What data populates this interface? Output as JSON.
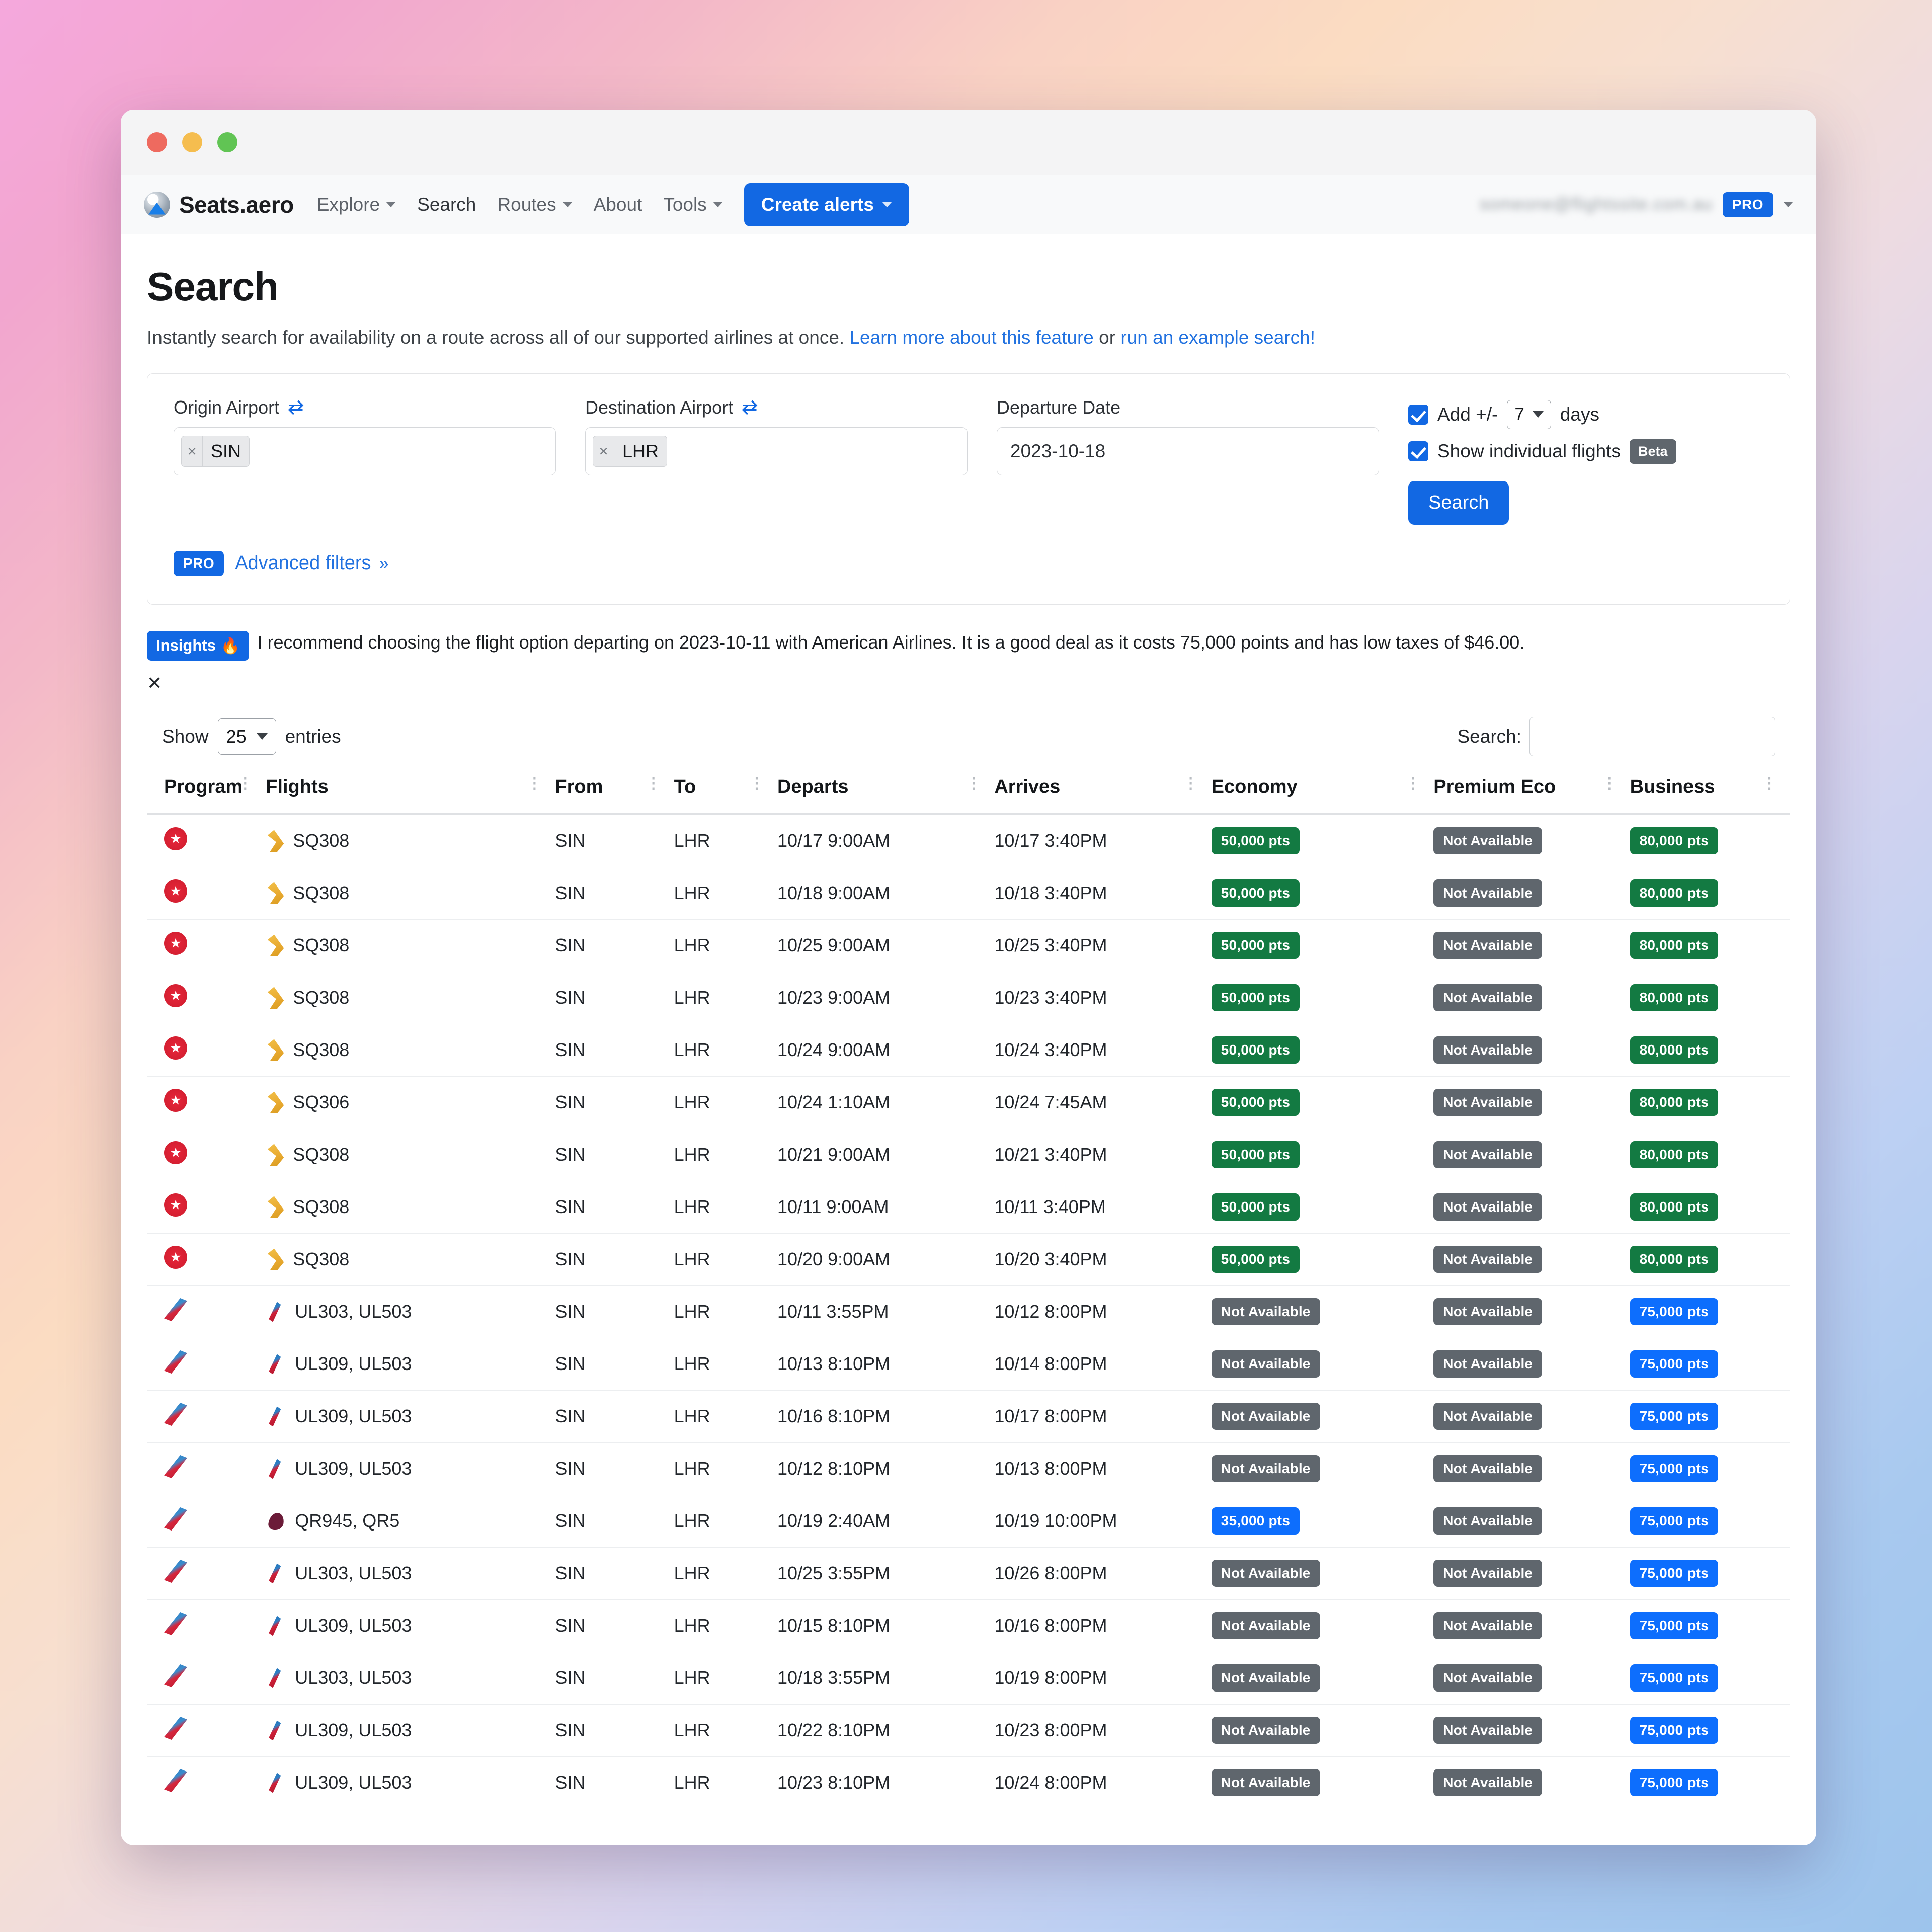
{
  "window": {
    "traffic_lights": [
      "close",
      "minimize",
      "maximize"
    ]
  },
  "nav": {
    "brand": "Seats.aero",
    "items": [
      {
        "label": "Explore",
        "caret": true,
        "active": false
      },
      {
        "label": "Search",
        "caret": false,
        "active": true
      },
      {
        "label": "Routes",
        "caret": true,
        "active": false
      },
      {
        "label": "About",
        "caret": false,
        "active": false
      },
      {
        "label": "Tools",
        "caret": true,
        "active": false
      }
    ],
    "create_alerts": "Create alerts",
    "user_email": "someone@flightssite.com.au",
    "pro_badge": "PRO"
  },
  "page": {
    "title": "Search",
    "lede_before": "Instantly search for availability on a route across all of our supported airlines at once. ",
    "lede_link1": "Learn more about this feature",
    "lede_mid": " or ",
    "lede_link2": "run an example search!"
  },
  "form": {
    "origin": {
      "label": "Origin Airport",
      "token": "SIN",
      "token_remove": "×"
    },
    "destination": {
      "label": "Destination Airport",
      "token": "LHR",
      "token_remove": "×"
    },
    "departure": {
      "label": "Departure Date",
      "value": "2023-10-18"
    },
    "add_days": {
      "prefix": "Add +/-",
      "value": "7",
      "suffix": "days",
      "checked": true
    },
    "individual_flights": {
      "label": "Show individual flights",
      "badge": "Beta",
      "checked": true
    },
    "search_button": "Search",
    "advanced": {
      "pro": "PRO",
      "label": "Advanced filters"
    }
  },
  "insights": {
    "badge": "Insights",
    "badge_icon": "🔥",
    "text": "I recommend choosing the flight option departing on 2023-10-11 with American Airlines. It is a good deal as it costs 75,000 points and has low taxes of $46.00.",
    "close": "✕"
  },
  "table_controls": {
    "show_label": "Show",
    "entries_value": "25",
    "entries_label": "entries",
    "search_label": "Search:",
    "search_value": ""
  },
  "table": {
    "columns": [
      "Program",
      "Flights",
      "From",
      "To",
      "Departs",
      "Arrives",
      "Economy",
      "Premium Eco",
      "Business"
    ],
    "rows": [
      {
        "program": "air-canada",
        "airline_logo": "singapore-airlines",
        "flights": "SQ308",
        "from": "SIN",
        "to": "LHR",
        "departs": "10/17 9:00AM",
        "arrives": "10/17 3:40PM",
        "economy": "50,000 pts",
        "economy_state": "green",
        "premium": "Not Available",
        "premium_state": "gray",
        "business": "80,000 pts",
        "business_state": "green"
      },
      {
        "program": "air-canada",
        "airline_logo": "singapore-airlines",
        "flights": "SQ308",
        "from": "SIN",
        "to": "LHR",
        "departs": "10/18 9:00AM",
        "arrives": "10/18 3:40PM",
        "economy": "50,000 pts",
        "economy_state": "green",
        "premium": "Not Available",
        "premium_state": "gray",
        "business": "80,000 pts",
        "business_state": "green"
      },
      {
        "program": "air-canada",
        "airline_logo": "singapore-airlines",
        "flights": "SQ308",
        "from": "SIN",
        "to": "LHR",
        "departs": "10/25 9:00AM",
        "arrives": "10/25 3:40PM",
        "economy": "50,000 pts",
        "economy_state": "green",
        "premium": "Not Available",
        "premium_state": "gray",
        "business": "80,000 pts",
        "business_state": "green"
      },
      {
        "program": "air-canada",
        "airline_logo": "singapore-airlines",
        "flights": "SQ308",
        "from": "SIN",
        "to": "LHR",
        "departs": "10/23 9:00AM",
        "arrives": "10/23 3:40PM",
        "economy": "50,000 pts",
        "economy_state": "green",
        "premium": "Not Available",
        "premium_state": "gray",
        "business": "80,000 pts",
        "business_state": "green"
      },
      {
        "program": "air-canada",
        "airline_logo": "singapore-airlines",
        "flights": "SQ308",
        "from": "SIN",
        "to": "LHR",
        "departs": "10/24 9:00AM",
        "arrives": "10/24 3:40PM",
        "economy": "50,000 pts",
        "economy_state": "green",
        "premium": "Not Available",
        "premium_state": "gray",
        "business": "80,000 pts",
        "business_state": "green"
      },
      {
        "program": "air-canada",
        "airline_logo": "singapore-airlines",
        "flights": "SQ306",
        "from": "SIN",
        "to": "LHR",
        "departs": "10/24 1:10AM",
        "arrives": "10/24 7:45AM",
        "economy": "50,000 pts",
        "economy_state": "green",
        "premium": "Not Available",
        "premium_state": "gray",
        "business": "80,000 pts",
        "business_state": "green"
      },
      {
        "program": "air-canada",
        "airline_logo": "singapore-airlines",
        "flights": "SQ308",
        "from": "SIN",
        "to": "LHR",
        "departs": "10/21 9:00AM",
        "arrives": "10/21 3:40PM",
        "economy": "50,000 pts",
        "economy_state": "green",
        "premium": "Not Available",
        "premium_state": "gray",
        "business": "80,000 pts",
        "business_state": "green"
      },
      {
        "program": "air-canada",
        "airline_logo": "singapore-airlines",
        "flights": "SQ308",
        "from": "SIN",
        "to": "LHR",
        "departs": "10/11 9:00AM",
        "arrives": "10/11 3:40PM",
        "economy": "50,000 pts",
        "economy_state": "green",
        "premium": "Not Available",
        "premium_state": "gray",
        "business": "80,000 pts",
        "business_state": "green"
      },
      {
        "program": "air-canada",
        "airline_logo": "singapore-airlines",
        "flights": "SQ308",
        "from": "SIN",
        "to": "LHR",
        "departs": "10/20 9:00AM",
        "arrives": "10/20 3:40PM",
        "economy": "50,000 pts",
        "economy_state": "green",
        "premium": "Not Available",
        "premium_state": "gray",
        "business": "80,000 pts",
        "business_state": "green"
      },
      {
        "program": "american-airlines",
        "airline_logo": "american-airlines",
        "flights": "UL303, UL503",
        "from": "SIN",
        "to": "LHR",
        "departs": "10/11 3:55PM",
        "arrives": "10/12 8:00PM",
        "economy": "Not Available",
        "economy_state": "gray",
        "premium": "Not Available",
        "premium_state": "gray",
        "business": "75,000 pts",
        "business_state": "blue"
      },
      {
        "program": "american-airlines",
        "airline_logo": "american-airlines",
        "flights": "UL309, UL503",
        "from": "SIN",
        "to": "LHR",
        "departs": "10/13 8:10PM",
        "arrives": "10/14 8:00PM",
        "economy": "Not Available",
        "economy_state": "gray",
        "premium": "Not Available",
        "premium_state": "gray",
        "business": "75,000 pts",
        "business_state": "blue"
      },
      {
        "program": "american-airlines",
        "airline_logo": "american-airlines",
        "flights": "UL309, UL503",
        "from": "SIN",
        "to": "LHR",
        "departs": "10/16 8:10PM",
        "arrives": "10/17 8:00PM",
        "economy": "Not Available",
        "economy_state": "gray",
        "premium": "Not Available",
        "premium_state": "gray",
        "business": "75,000 pts",
        "business_state": "blue"
      },
      {
        "program": "american-airlines",
        "airline_logo": "american-airlines",
        "flights": "UL309, UL503",
        "from": "SIN",
        "to": "LHR",
        "departs": "10/12 8:10PM",
        "arrives": "10/13 8:00PM",
        "economy": "Not Available",
        "economy_state": "gray",
        "premium": "Not Available",
        "premium_state": "gray",
        "business": "75,000 pts",
        "business_state": "blue"
      },
      {
        "program": "american-airlines",
        "airline_logo": "qatar-airways",
        "flights": "QR945, QR5",
        "from": "SIN",
        "to": "LHR",
        "departs": "10/19 2:40AM",
        "arrives": "10/19 10:00PM",
        "economy": "35,000 pts",
        "economy_state": "blue",
        "premium": "Not Available",
        "premium_state": "gray",
        "business": "75,000 pts",
        "business_state": "blue"
      },
      {
        "program": "american-airlines",
        "airline_logo": "american-airlines",
        "flights": "UL303, UL503",
        "from": "SIN",
        "to": "LHR",
        "departs": "10/25 3:55PM",
        "arrives": "10/26 8:00PM",
        "economy": "Not Available",
        "economy_state": "gray",
        "premium": "Not Available",
        "premium_state": "gray",
        "business": "75,000 pts",
        "business_state": "blue"
      },
      {
        "program": "american-airlines",
        "airline_logo": "american-airlines",
        "flights": "UL309, UL503",
        "from": "SIN",
        "to": "LHR",
        "departs": "10/15 8:10PM",
        "arrives": "10/16 8:00PM",
        "economy": "Not Available",
        "economy_state": "gray",
        "premium": "Not Available",
        "premium_state": "gray",
        "business": "75,000 pts",
        "business_state": "blue"
      },
      {
        "program": "american-airlines",
        "airline_logo": "american-airlines",
        "flights": "UL303, UL503",
        "from": "SIN",
        "to": "LHR",
        "departs": "10/18 3:55PM",
        "arrives": "10/19 8:00PM",
        "economy": "Not Available",
        "economy_state": "gray",
        "premium": "Not Available",
        "premium_state": "gray",
        "business": "75,000 pts",
        "business_state": "blue"
      },
      {
        "program": "american-airlines",
        "airline_logo": "american-airlines",
        "flights": "UL309, UL503",
        "from": "SIN",
        "to": "LHR",
        "departs": "10/22 8:10PM",
        "arrives": "10/23 8:00PM",
        "economy": "Not Available",
        "economy_state": "gray",
        "premium": "Not Available",
        "premium_state": "gray",
        "business": "75,000 pts",
        "business_state": "blue"
      },
      {
        "program": "american-airlines",
        "airline_logo": "american-airlines",
        "flights": "UL309, UL503",
        "from": "SIN",
        "to": "LHR",
        "departs": "10/23 8:10PM",
        "arrives": "10/24 8:00PM",
        "economy": "Not Available",
        "economy_state": "gray",
        "premium": "Not Available",
        "premium_state": "gray",
        "business": "75,000 pts",
        "business_state": "blue"
      }
    ]
  },
  "colors": {
    "accent_blue": "#1268e3",
    "pill_green": "#137a42",
    "pill_blue": "#0d6efd",
    "pill_gray": "#5f666d"
  }
}
